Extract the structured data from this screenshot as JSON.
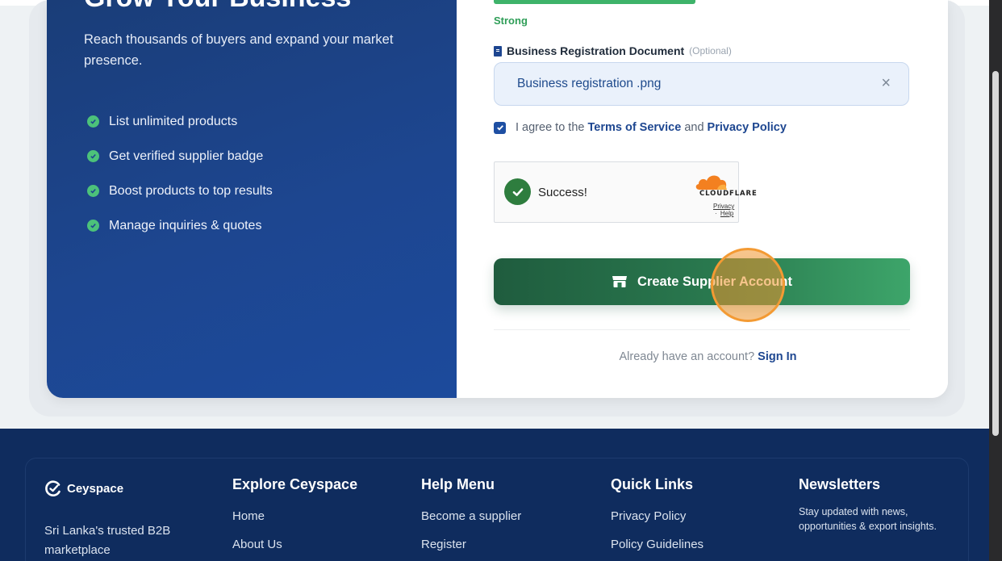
{
  "promo": {
    "heading": "Grow Your Business",
    "description": "Reach thousands of buyers and expand your market presence.",
    "features": [
      "List unlimited products",
      "Get verified supplier badge",
      "Boost products to top results",
      "Manage inquiries & quotes"
    ]
  },
  "form": {
    "password_strength": "Strong",
    "password_strength_level": 1.0,
    "document_label": "Business Registration Document",
    "document_optional": "(Optional)",
    "document_file": "Business registration .png",
    "agree_prefix": "I agree to the",
    "terms_link": "Terms of Service",
    "agree_and": "and",
    "privacy_link": "Privacy Policy",
    "agree_checked": true,
    "captcha_status": "Success!",
    "captcha_brand": "CLOUDFLARE",
    "captcha_privacy": "Privacy",
    "captcha_sep": "·",
    "captcha_help": "Help",
    "submit_label": "Create Supplier Account",
    "signin_prompt": "Already have an account?",
    "signin_link": "Sign In"
  },
  "footer": {
    "brand": "Ceyspace",
    "brand_desc": "Sri Lanka's trusted B2B marketplace",
    "columns": [
      {
        "title": "Explore Ceyspace",
        "links": [
          "Home",
          "About Us"
        ]
      },
      {
        "title": "Help Menu",
        "links": [
          "Become a supplier",
          "Register"
        ]
      },
      {
        "title": "Quick Links",
        "links": [
          "Privacy Policy",
          "Policy Guidelines"
        ]
      }
    ],
    "newsletter_title": "Newsletters",
    "newsletter_text": "Stay updated with news, opportunities & export insights."
  },
  "colors": {
    "brand_blue": "#1d4690",
    "success_green": "#2f9e58",
    "button_green": "#2a7a4f",
    "footer_bg": "#0f2c5e",
    "click_highlight": "#f39a33"
  }
}
